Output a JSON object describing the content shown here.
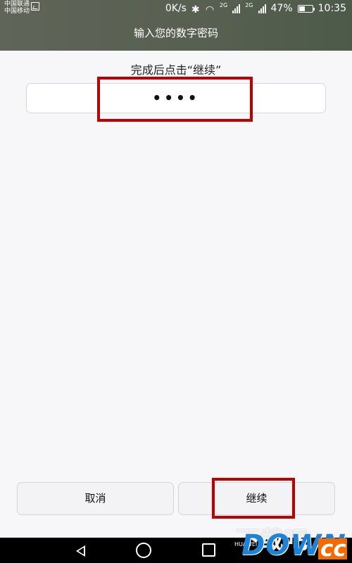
{
  "status_bar": {
    "carrier_1": "中国联通",
    "carrier_2": "中国移动",
    "speed": "0K/s",
    "network_1": "2G",
    "network_2": "2G",
    "battery": "47%",
    "time": "10:35",
    "battery_level": 0.47
  },
  "header": {
    "title": "输入您的数字密码"
  },
  "main": {
    "instruction": "完成后点击“继续”",
    "pin_value": "••••"
  },
  "buttons": {
    "cancel": "取消",
    "continue": "继续"
  },
  "watermark": {
    "top_text": "下载吧",
    "brand": "HUAWEI",
    "logo_main": "DOWN",
    "logo_dot": ".",
    "logo_suffix": "cc"
  },
  "colors": {
    "accent_red": "#c00000",
    "header_bg": "#586052",
    "nav_bg": "#000000"
  }
}
